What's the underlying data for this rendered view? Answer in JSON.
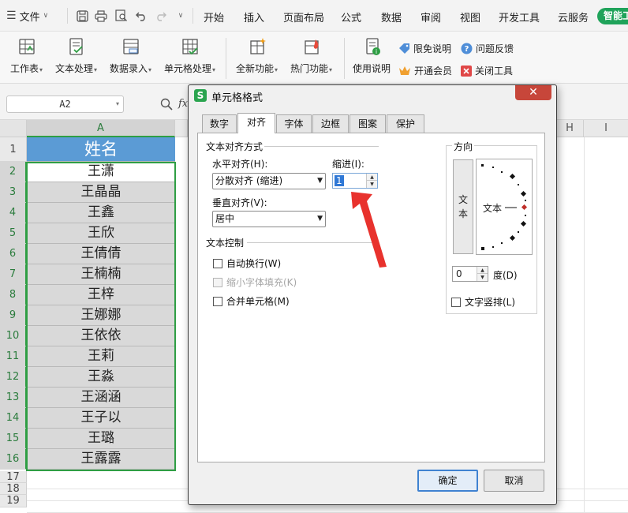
{
  "menubar": {
    "file_label": "文件",
    "items": [
      "开始",
      "插入",
      "页面布局",
      "公式",
      "数据",
      "审阅",
      "视图",
      "开发工具",
      "云服务"
    ],
    "smart_label": "智能工"
  },
  "ribbon": {
    "buttons": [
      "工作表",
      "文本处理",
      "数据录入",
      "单元格处理",
      "全新功能",
      "热门功能",
      "使用说明"
    ],
    "side_items": [
      "限免说明",
      "问题反馈",
      "开通会员",
      "关闭工具"
    ]
  },
  "formula_bar": {
    "name_box": "A2",
    "fx_label": "fx"
  },
  "sheet": {
    "columns": [
      "A",
      "H",
      "I"
    ],
    "rows": [
      "1",
      "2",
      "3",
      "4",
      "5",
      "6",
      "7",
      "8",
      "9",
      "10",
      "11",
      "12",
      "13",
      "14",
      "15",
      "16",
      "17",
      "18",
      "19"
    ],
    "header_cell": "姓名",
    "names": [
      "王潇",
      "王晶晶",
      "王鑫",
      "王欣",
      "王倩倩",
      "王楠楠",
      "王梓",
      "王娜娜",
      "王依依",
      "王莉",
      "王淼",
      "王涵涵",
      "王子以",
      "王璐",
      "王露露"
    ]
  },
  "dialog": {
    "title": "单元格格式",
    "close_label": "✕",
    "tabs": [
      "数字",
      "对齐",
      "字体",
      "边框",
      "图案",
      "保护"
    ],
    "alignment": {
      "group_label": "文本对齐方式",
      "horizontal_label": "水平对齐(H):",
      "horizontal_value": "分散对齐 (缩进)",
      "indent_label": "缩进(I):",
      "indent_value": "1",
      "vertical_label": "垂直对齐(V):",
      "vertical_value": "居中"
    },
    "text_control": {
      "group_label": "文本控制",
      "wrap": "自动换行(W)",
      "shrink": "缩小字体填充(K)",
      "merge": "合并单元格(M)"
    },
    "orientation": {
      "group_label": "方向",
      "vertical_text_chars": [
        "文",
        "本"
      ],
      "dial_text": "文本",
      "degrees_value": "0",
      "degrees_label": "度(D)",
      "vertical_layout": "文字竖排(L)"
    },
    "ok_label": "确定",
    "cancel_label": "取消"
  },
  "colors": {
    "header_fill": "#5b9bd5",
    "name_fill": "#d9d9d9",
    "selection": "#2f9e44",
    "annotation_arrow": "#e8322d",
    "accent": "#1fa35a"
  }
}
